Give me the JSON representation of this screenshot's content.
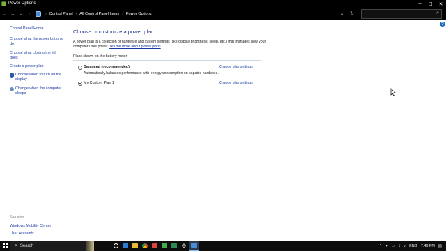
{
  "window": {
    "title": "Power Options",
    "controls": {
      "minimize": "–",
      "maximize": "☐",
      "close": "✕"
    }
  },
  "address_bar": {
    "breadcrumbs": [
      "Control Panel",
      "All Control Panel Items",
      "Power Options"
    ],
    "search_placeholder": ""
  },
  "sidebar": {
    "home": "Control Panel Home",
    "links": [
      "Choose what the power buttons do",
      "Choose what closing the lid does",
      "Create a power plan",
      "Choose when to turn off the display",
      "Change when the computer sleeps"
    ],
    "see_also_label": "See also",
    "see_also": [
      "Windows Mobility Center",
      "User Accounts"
    ]
  },
  "main": {
    "heading": "Choose or customize a power plan",
    "intro": "A power plan is a collection of hardware and system settings (like display brightness, sleep, etc.) that manages how your computer uses power.",
    "intro_link": "Tell me more about power plans",
    "group_label": "Plans shown on the battery meter",
    "plans": [
      {
        "name": "Balanced (recommended)",
        "description": "Automatically balances performance with energy consumption on capable hardware.",
        "change": "Change plan settings",
        "selected": false
      },
      {
        "name": "My Custom Plan 1",
        "description": "",
        "change": "Change plan settings",
        "selected": true
      }
    ]
  },
  "taskbar": {
    "search_label": "Search",
    "language": "ENG",
    "time": "7:46 PM",
    "icons": [
      "task-view-icon",
      "edge-icon",
      "file-explorer-icon",
      "chrome-icon",
      "app-icon",
      "app-icon",
      "app-icon",
      "settings-icon",
      "control-panel-icon"
    ],
    "tray_icons": [
      "microphone-icon",
      "battery-icon",
      "network-icon",
      "volume-icon"
    ]
  },
  "colors": {
    "link": "#1a3aa3",
    "heading": "#1e3287",
    "taskbar": "#0d0d0d"
  }
}
